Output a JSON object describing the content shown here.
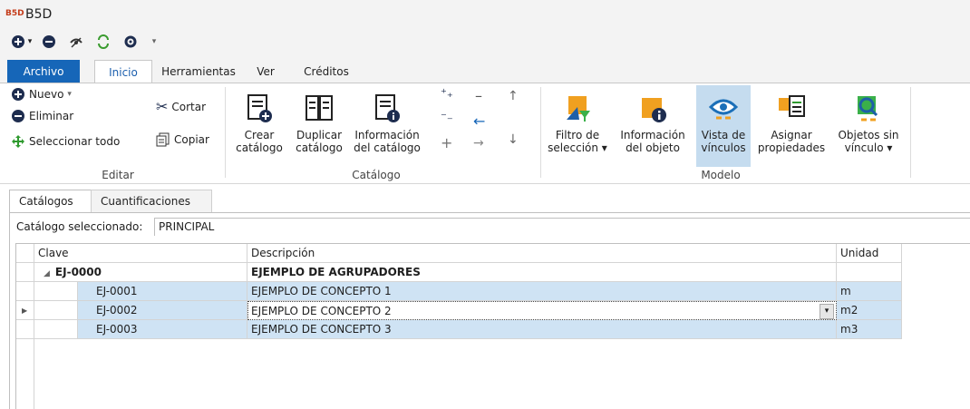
{
  "app": {
    "logo_text": "B5D",
    "title": "B5D"
  },
  "quick_access": {
    "icons": [
      "add-circle-icon",
      "remove-circle-icon",
      "eye-slash-icon",
      "refresh-icon",
      "gear-icon",
      "dropdown-arrow-icon"
    ]
  },
  "tabs": [
    "Archivo",
    "Inicio",
    "Herramientas",
    "Ver",
    "Créditos"
  ],
  "ribbon": {
    "editar": {
      "nuevo": "Nuevo",
      "eliminar": "Eliminar",
      "seleccionar_todo": "Seleccionar todo",
      "cortar": "Cortar",
      "copiar": "Copiar",
      "group_label": "Editar"
    },
    "catalogo": {
      "crear": [
        "Crear",
        "catálogo"
      ],
      "duplicar": [
        "Duplicar",
        "catálogo"
      ],
      "informacion": [
        "Información",
        "del catálogo"
      ],
      "group_label": "Catálogo"
    },
    "modelo": {
      "filtro": [
        "Filtro de",
        "selección ▾"
      ],
      "info_objeto": [
        "Información",
        "del objeto"
      ],
      "vista": [
        "Vista de",
        "vínculos"
      ],
      "asignar": [
        "Asignar",
        "propiedades"
      ],
      "objetos": [
        "Objetos sin",
        "vínculo ▾"
      ],
      "group_label": "Modelo"
    }
  },
  "doc_tabs": [
    "Catálogos",
    "Cuantificaciones"
  ],
  "catalog_selector": {
    "label": "Catálogo seleccionado:",
    "value": "PRINCIPAL"
  },
  "grid": {
    "headers": {
      "clave": "Clave",
      "descripcion": "Descripción",
      "unidad": "Unidad"
    },
    "group_row": {
      "clave": "EJ-0000",
      "descripcion": "EJEMPLO DE AGRUPADORES",
      "unidad": ""
    },
    "rows": [
      {
        "clave": "EJ-0001",
        "descripcion": "EJEMPLO DE CONCEPTO 1",
        "unidad": "m"
      },
      {
        "clave": "EJ-0002",
        "descripcion": "EJEMPLO DE CONCEPTO 2",
        "unidad": "m2"
      },
      {
        "clave": "EJ-0003",
        "descripcion": "EJEMPLO DE CONCEPTO 3",
        "unidad": "m3"
      }
    ]
  },
  "colors": {
    "accent": "#1666b8",
    "selected_row": "#cfe3f4",
    "selected_button": "#c5dcef"
  }
}
